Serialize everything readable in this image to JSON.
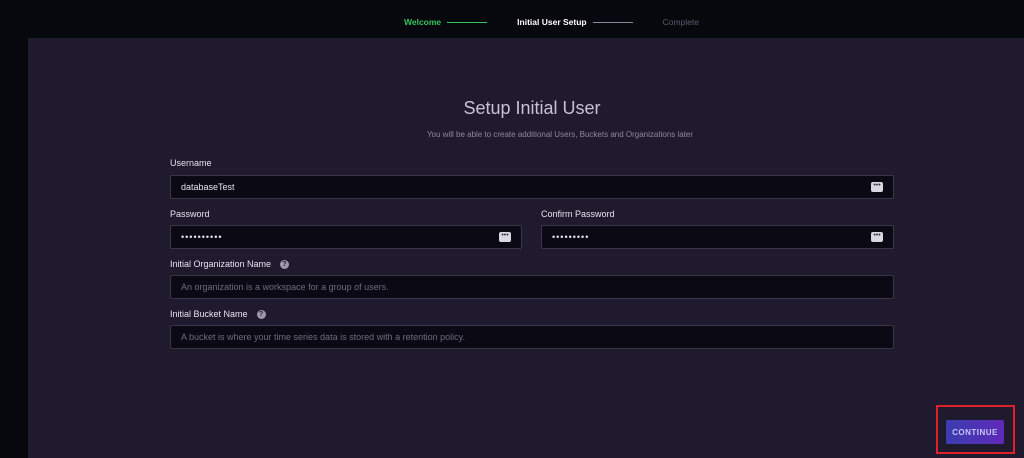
{
  "stepper": {
    "steps": [
      {
        "label": "Welcome",
        "state": "done"
      },
      {
        "label": "Initial User Setup",
        "state": "active"
      },
      {
        "label": "Complete",
        "state": "pending"
      }
    ]
  },
  "form": {
    "title": "Setup Initial User",
    "subtitle": "You will be able to create additional Users, Buckets and Organizations later",
    "username": {
      "label": "Username",
      "value": "databaseTest"
    },
    "password": {
      "label": "Password",
      "value": "••••••••••"
    },
    "confirm_password": {
      "label": "Confirm Password",
      "value": "•••••••••"
    },
    "org_name": {
      "label": "Initial Organization Name",
      "placeholder": "An organization is a workspace for a group of users."
    },
    "bucket_name": {
      "label": "Initial Bucket Name",
      "placeholder": "A bucket is where your time series data is stored with a retention policy."
    },
    "help_glyph": "?",
    "key_glyph": "•••"
  },
  "actions": {
    "continue_label": "CONTINUE"
  },
  "colors": {
    "background": "#07070e",
    "panel": "#1f1a2e",
    "step_done": "#34c759",
    "button_gradient_start": "#3b3cb0",
    "button_gradient_end": "#5f2ab8",
    "highlight": "#e0202a"
  }
}
